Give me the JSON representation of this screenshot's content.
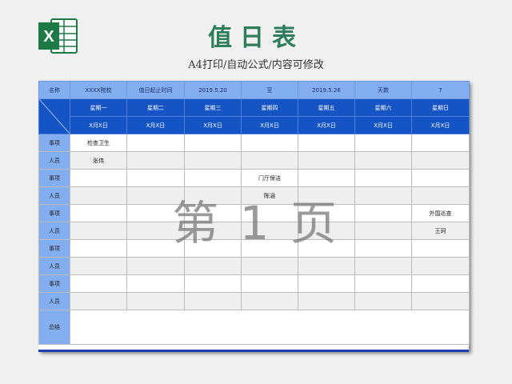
{
  "header": {
    "title": "值日表",
    "subtitle": "A4打印/自动公式/内容可修改"
  },
  "logo": {
    "icon": "excel-logo-icon",
    "letter": "X",
    "color": "#1d7a44"
  },
  "table": {
    "row1": {
      "name_label": "名称",
      "name_value": "XXXX院校",
      "period_label": "值日起止时间",
      "start_date": "2019.5.20",
      "to": "至",
      "end_date": "2019.5.26",
      "days_label": "天数",
      "days_value": "7"
    },
    "weekdays": [
      "星期一",
      "星期二",
      "星期三",
      "星期四",
      "星期五",
      "星期六",
      "星期日"
    ],
    "dates": [
      "X月X日",
      "X月X日",
      "X月X日",
      "X月X日",
      "X月X日",
      "X月X日",
      "X月X日"
    ],
    "rows": [
      {
        "label": "事项",
        "cells": [
          "检查卫生",
          "",
          "",
          "",
          "",
          "",
          ""
        ]
      },
      {
        "label": "人员",
        "cells": [
          "张伟",
          "",
          "",
          "",
          "",
          "",
          ""
        ]
      },
      {
        "label": "事项",
        "cells": [
          "",
          "",
          "",
          "门厅保洁",
          "",
          "",
          ""
        ]
      },
      {
        "label": "人员",
        "cells": [
          "",
          "",
          "",
          "陈涵",
          "",
          "",
          ""
        ]
      },
      {
        "label": "事项",
        "cells": [
          "",
          "",
          "",
          "",
          "",
          "",
          "外围巡查"
        ]
      },
      {
        "label": "人员",
        "cells": [
          "",
          "",
          "",
          "",
          "",
          "",
          "王珂"
        ]
      },
      {
        "label": "事项",
        "cells": [
          "",
          "",
          "",
          "",
          "",
          "",
          ""
        ]
      },
      {
        "label": "人员",
        "cells": [
          "",
          "",
          "",
          "",
          "",
          "",
          ""
        ]
      },
      {
        "label": "事项",
        "cells": [
          "",
          "",
          "",
          "",
          "",
          "",
          ""
        ]
      },
      {
        "label": "人员",
        "cells": [
          "",
          "",
          "",
          "",
          "",
          "",
          ""
        ]
      }
    ],
    "summary_label": "总结",
    "summary_value": ""
  },
  "watermark": "第 1 页",
  "colors": {
    "header_light": "#83aef0",
    "header_dark": "#1554c4",
    "title_green": "#2e7d5b"
  }
}
